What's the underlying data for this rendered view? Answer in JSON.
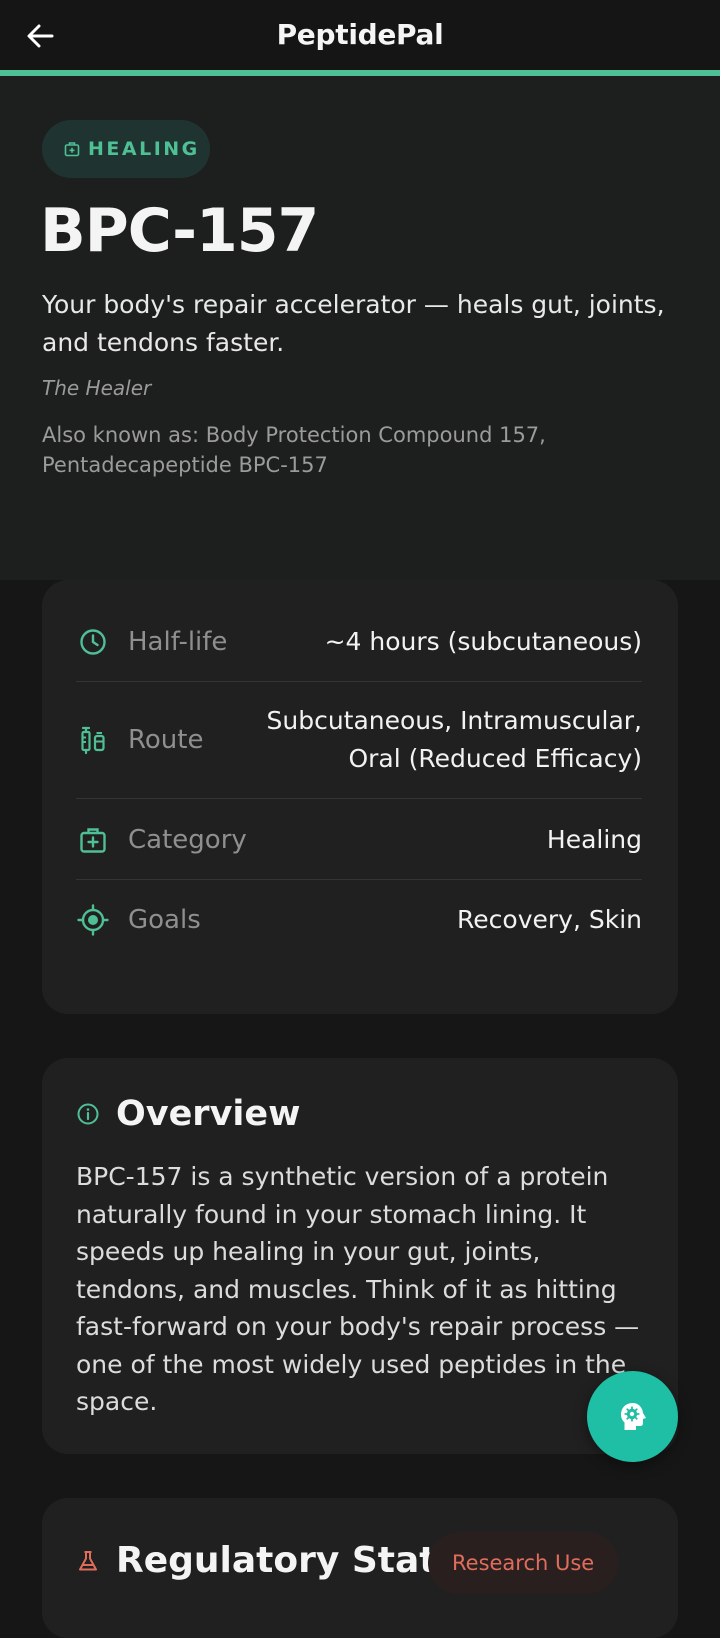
{
  "header": {
    "title": "PeptidePal",
    "back_icon": "arrow-left-icon"
  },
  "colors": {
    "accent": "#4fbf95",
    "fab": "#1fbfa5",
    "warning": "#e06d5c"
  },
  "hero": {
    "tag": "HEALING",
    "title": "BPC-157",
    "description": "Your body's repair accelerator — heals gut, joints, and tendons faster.",
    "nickname": "The Healer",
    "aka": "Also known as: Body Protection Compound 157, Pentadecapeptide BPC-157"
  },
  "facts": [
    {
      "icon": "clock-icon",
      "label": "Half-life",
      "value": "~4 hours (subcutaneous)"
    },
    {
      "icon": "syringe-icon",
      "label": "Route",
      "value": "Subcutaneous, Intramuscular, Oral (Reduced Efficacy)"
    },
    {
      "icon": "medical-kit-icon",
      "label": "Category",
      "value": "Healing"
    },
    {
      "icon": "target-icon",
      "label": "Goals",
      "value": "Recovery, Skin"
    }
  ],
  "overview": {
    "title": "Overview",
    "body": "BPC-157 is a synthetic version of a protein naturally found in your stomach lining. It speeds up healing in your gut, joints, tendons, and muscles. Think of it as hitting fast-forward on your body's repair process — one of the most widely used peptides in the space."
  },
  "regulatory": {
    "title": "Regulatory Status",
    "badge": "Research Use"
  },
  "fab": {
    "icon": "ai-assistant-icon"
  }
}
